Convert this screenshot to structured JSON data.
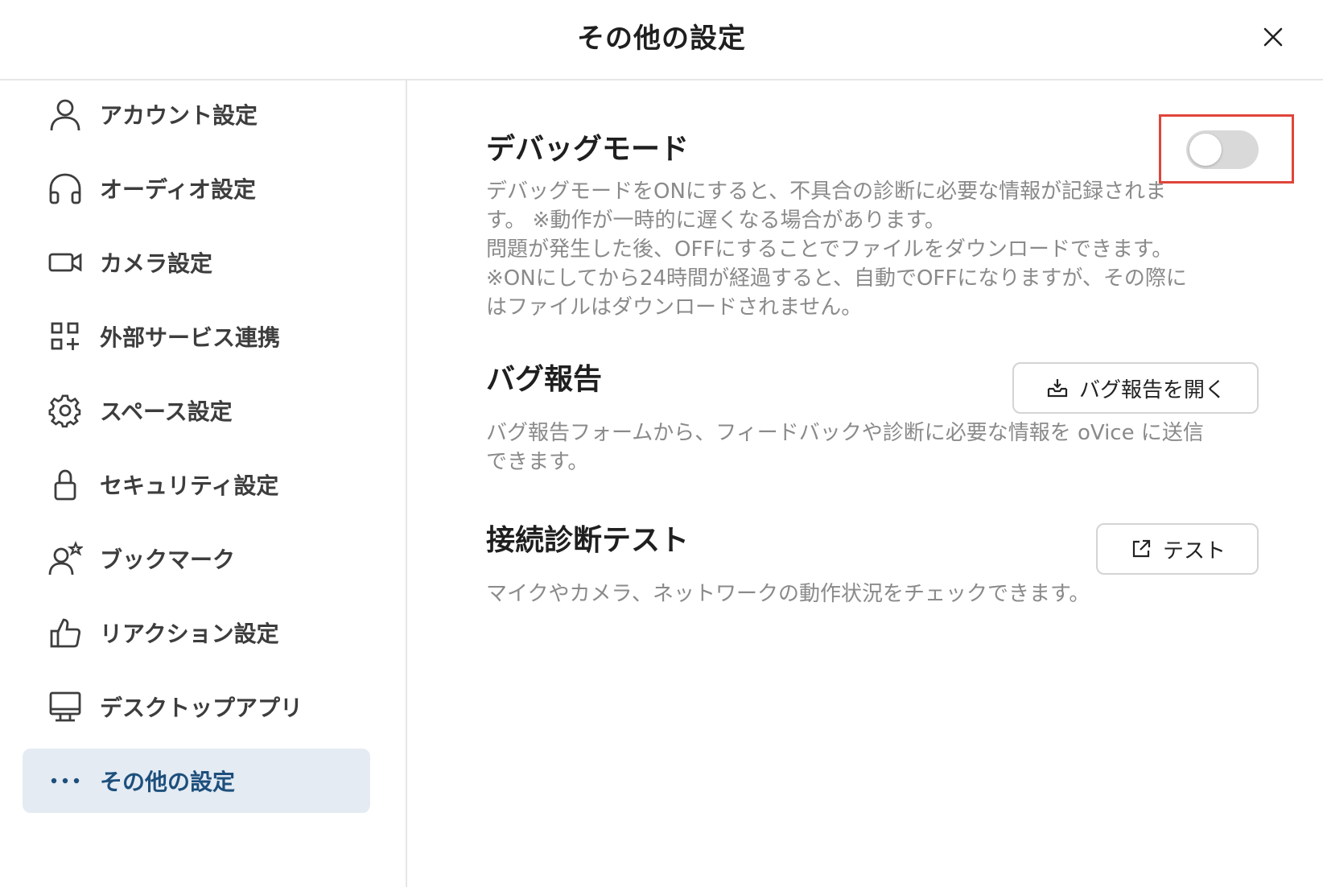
{
  "header": {
    "title": "その他の設定"
  },
  "sidebar": {
    "items": [
      {
        "label": "アカウント設定",
        "icon": "user-icon"
      },
      {
        "label": "オーディオ設定",
        "icon": "headphones-icon"
      },
      {
        "label": "カメラ設定",
        "icon": "video-camera-icon"
      },
      {
        "label": "外部サービス連携",
        "icon": "apps-grid-icon"
      },
      {
        "label": "スペース設定",
        "icon": "gear-icon"
      },
      {
        "label": "セキュリティ設定",
        "icon": "lock-icon"
      },
      {
        "label": "ブックマーク",
        "icon": "user-star-icon"
      },
      {
        "label": "リアクション設定",
        "icon": "thumbs-up-icon"
      },
      {
        "label": "デスクトップアプリ",
        "icon": "monitor-icon"
      },
      {
        "label": "その他の設定",
        "icon": "more-dots-icon",
        "active": true
      }
    ]
  },
  "main": {
    "debug": {
      "title": "デバッグモード",
      "description": "デバッグモードをONにすると、不具合の診断に必要な情報が記録されま\nす。 ※動作が一時的に遅くなる場合があります。\n問題が発生した後、OFFにすることでファイルをダウンロードできます。\n※ONにしてから24時間が経過すると、自動でOFFになりますが、その際に\nはファイルはダウンロードされません。",
      "enabled": false
    },
    "bug_report": {
      "title": "バグ報告",
      "button_label": "バグ報告を開く",
      "button_icon": "inbox-download-icon",
      "description": "バグ報告フォームから、フィードバックや診断に必要な情報を oVice に送信\nできます。"
    },
    "connection_test": {
      "title": "接続診断テスト",
      "button_label": "テスト",
      "button_icon": "external-link-icon",
      "description": "マイクやカメラ、ネットワークの動作状況をチェックできます。"
    }
  },
  "colors": {
    "active_bg": "#e4ebf3",
    "active_text": "#1d4f7c",
    "highlight": "#e0443a",
    "toggle_off": "#d9d9d9"
  }
}
